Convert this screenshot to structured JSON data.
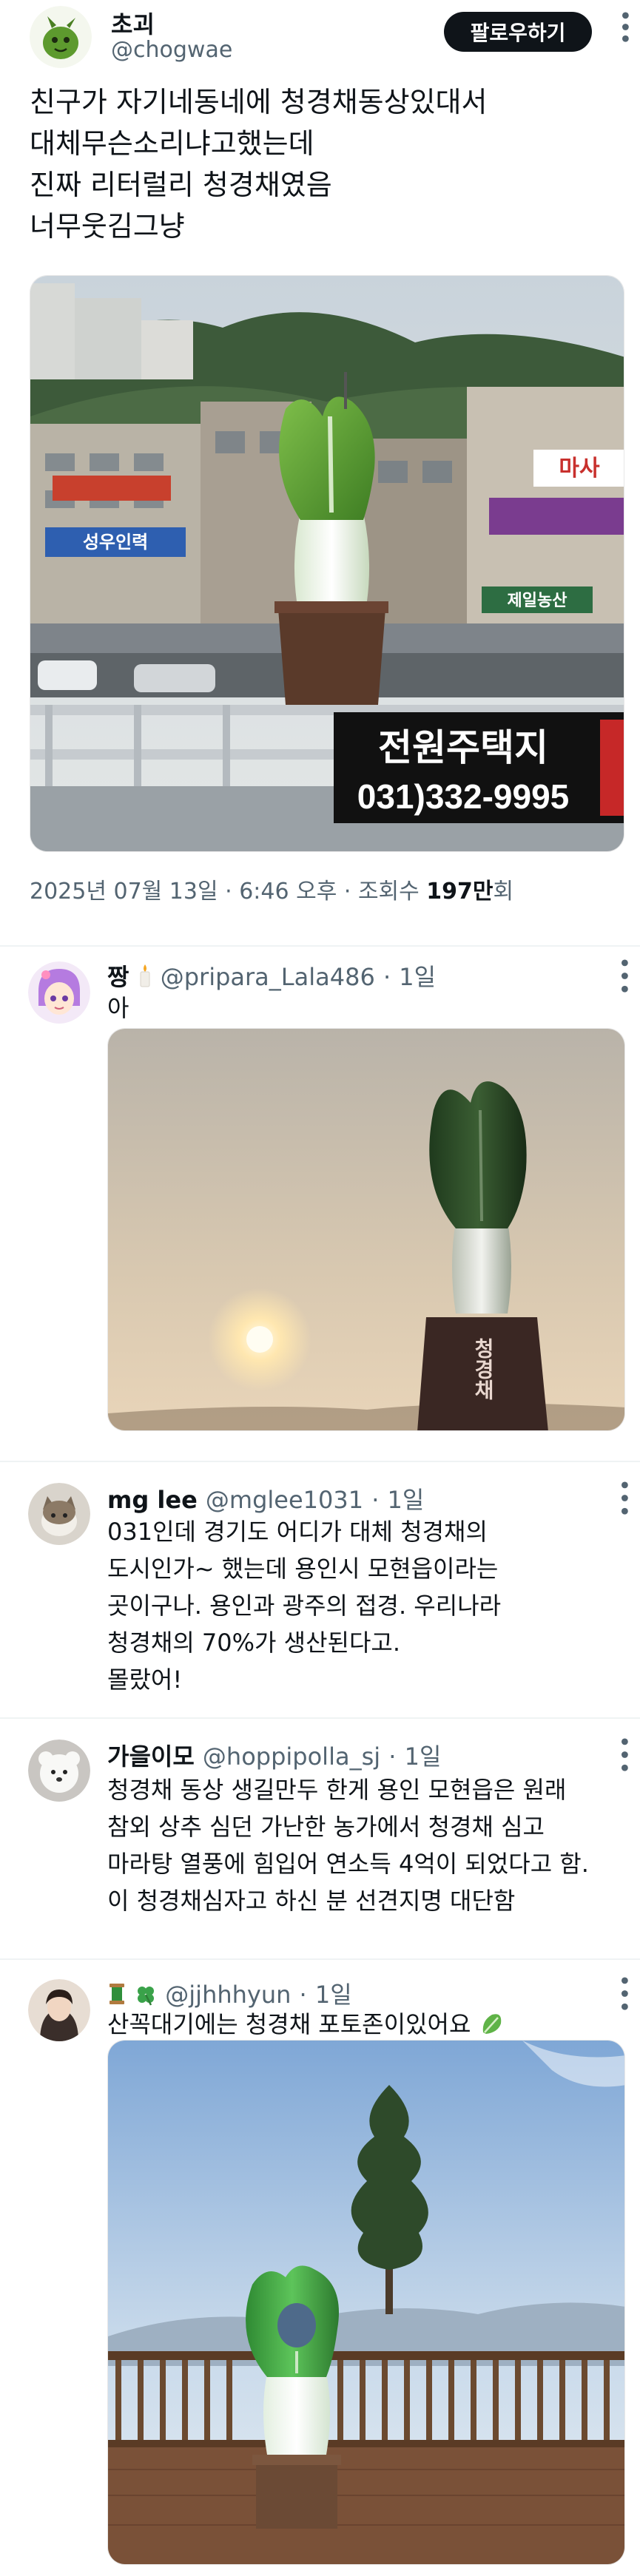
{
  "main_tweet": {
    "author_name": "초괴",
    "author_handle": "@chogwae",
    "follow_label": "팔로우하기",
    "text_lines": [
      "친구가 자기네동네에 청경채동상있대서",
      "대체무슨소리냐고했는데",
      "진짜 리터럴리 청경채였음",
      "너무웃김그냥"
    ],
    "date": "2025년 07월 13일",
    "time": "6:46 오후",
    "views_label": "조회수",
    "views_count": "197만",
    "views_suffix": "회",
    "image_sign_text": "전원주택지",
    "image_sign_phone": "031)332-9995",
    "image_shop_signs": [
      "마사",
      "성우인력",
      "제일농산"
    ]
  },
  "replies": [
    {
      "name": "짱",
      "handle": "@pripara_Lala486",
      "time": "1일",
      "text_lines": [
        "아"
      ],
      "image_pillar_text": "청경채"
    },
    {
      "name": "mg lee",
      "handle": "@mglee1031",
      "time": "1일",
      "text_lines": [
        "031인데 경기도 어디가 대체 청경채의",
        "도시인가~ 했는데 용인시 모현읍이라는",
        "곳이구나. 용인과 광주의 접경. 우리나라",
        "청경채의 70%가 생산된다고.",
        "몰랐어!"
      ]
    },
    {
      "name": "가을이모",
      "handle": "@hoppipolla_sj",
      "time": "1일",
      "text_lines": [
        "청경채 동상 생길만두 한게 용인 모현읍은 원래",
        "참외 상추 심던 가난한 농가에서 청경채 심고",
        "마라탕 열풍에 힘입어 연소득 4억이 되었다고 함.",
        "이 청경채심자고 하신 분 선견지명 대단함"
      ]
    },
    {
      "name": "",
      "handle": "@jjhhhyun",
      "time": "1일",
      "text_lines": [
        "산꼭대기에는 청경채 포토존이있어요"
      ]
    }
  ],
  "colors": {
    "text_primary": "#0f1419",
    "text_secondary": "#536471",
    "divider": "#eff3f4",
    "follow_bg": "#0f1419"
  },
  "icons": {
    "kebab": "more-icon",
    "candle": "candle-emoji",
    "spool": "thread-spool-emoji",
    "clover": "clover-emoji",
    "leafy_green": "leafy-green-emoji"
  }
}
